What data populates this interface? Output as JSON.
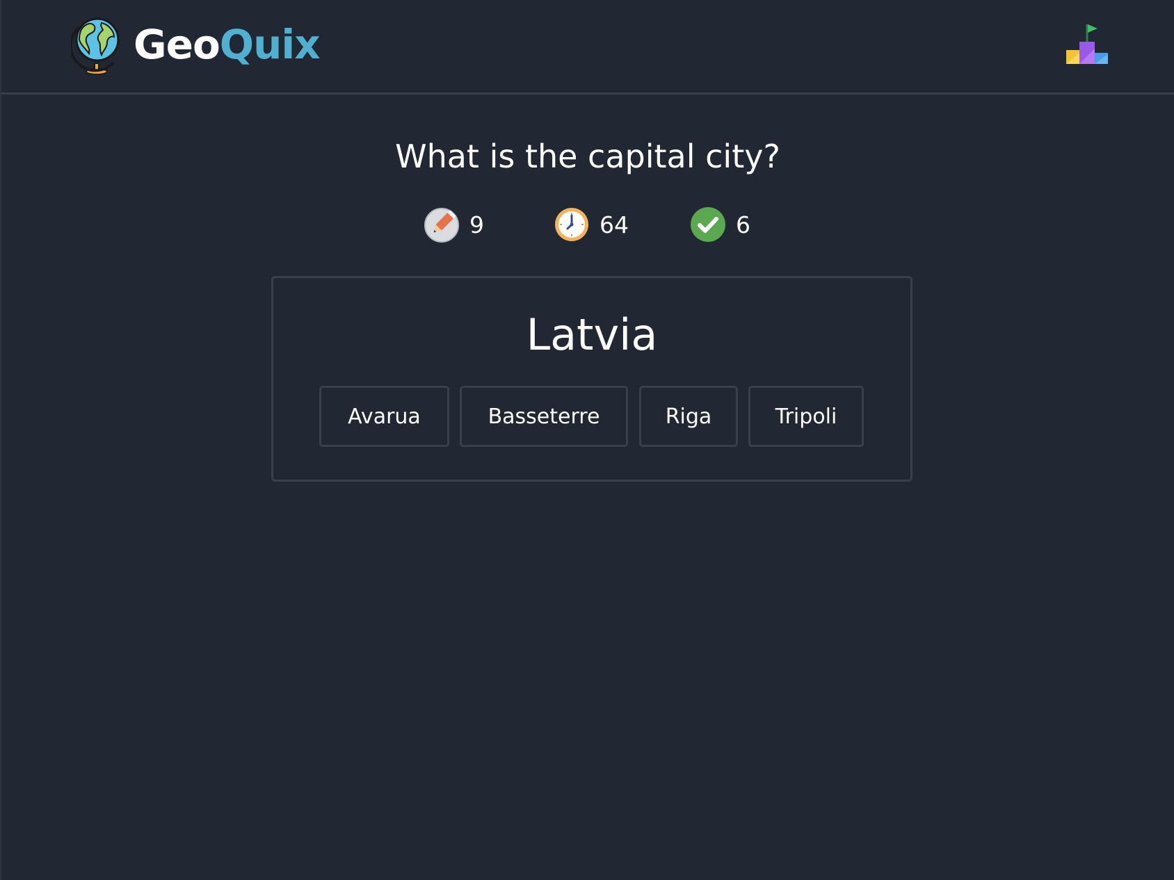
{
  "header": {
    "brand_part1": "Geo",
    "brand_part2": "Quix",
    "logo_icon": "globe-icon",
    "leaderboard_icon": "podium-icon"
  },
  "question": "What is the capital city?",
  "stats": {
    "remaining": {
      "icon": "pencil-icon",
      "value": "9"
    },
    "timer": {
      "icon": "clock-icon",
      "value": "64"
    },
    "correct": {
      "icon": "checkmark-icon",
      "value": "6"
    }
  },
  "card": {
    "country": "Latvia",
    "options": [
      "Avarua",
      "Basseterre",
      "Riga",
      "Tripoli"
    ]
  },
  "colors": {
    "background": "#212733",
    "border": "#3a404b",
    "accent": "#4fb0cf",
    "success": "#5aa84f"
  }
}
